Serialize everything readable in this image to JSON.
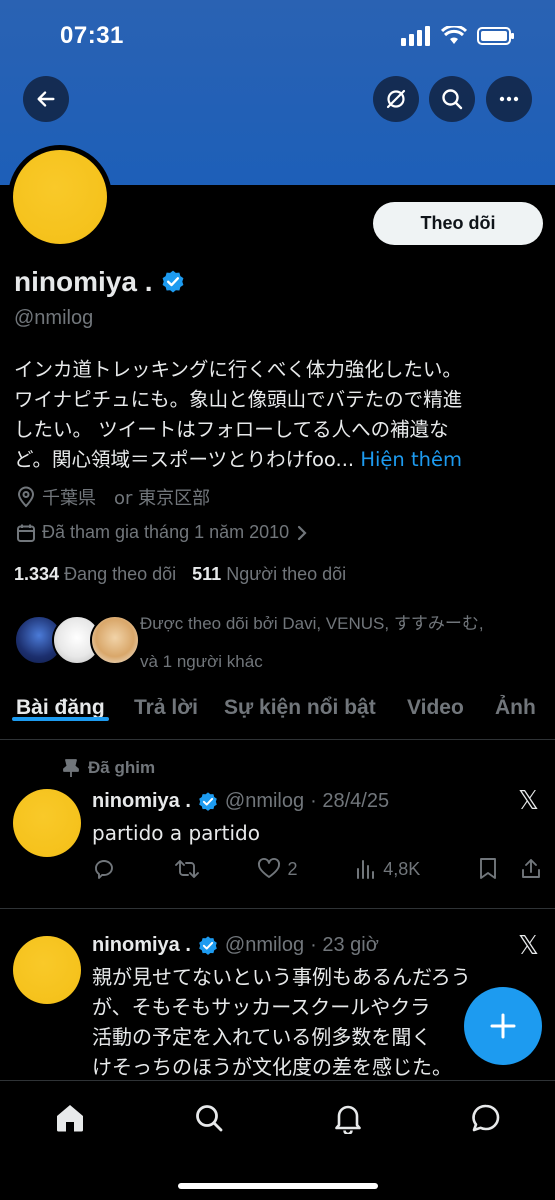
{
  "status_bar": {
    "time": "07:31"
  },
  "profile": {
    "display_name": "ninomiya .",
    "handle": "@nmilog",
    "follow_label": "Theo dõi",
    "bio_lines": [
      "インカ道トレッキングに行くべく体力強化したい。",
      "ワイナピチュにも。象山と像頭山でバテたので精進",
      "したい。 ツイートはフォローしてる人への補遺な",
      "ど。関心領域＝スポーツとりわけfoo..."
    ],
    "bio_more": "Hiện thêm",
    "location": "千葉県　or 東京区部",
    "joined": "Đã tham gia tháng 1 năm 2010",
    "following_count": "1.334",
    "following_label": "Đang theo dõi",
    "followers_count": "511",
    "followers_label": "Người theo dõi",
    "followed_by_line1": "Được theo dõi bởi Davi, VENUS, すすみーむ,",
    "followed_by_line2": "và 1 người khác"
  },
  "tabs": [
    "Bài đăng",
    "Trả lời",
    "Sự kiện nổi bật",
    "Video",
    "Ảnh"
  ],
  "posts": [
    {
      "pinned_label": "Đã ghim",
      "name": "ninomiya .",
      "handle": "@nmilog",
      "time": "· 28/4/25",
      "text": "partido a partido",
      "likes": "2",
      "views": "4,8K"
    },
    {
      "name": "ninomiya .",
      "handle": "@nmilog",
      "time": "· 23 giờ",
      "text_lines": [
        "親が見せてないという事例もあるんだろう",
        "が、そもそもサッカースクールやクラ",
        "活動の予定を入れている例多数を聞く",
        "けそっちのほうが文化度の差を感じた。"
      ]
    }
  ],
  "colors": {
    "accent": "#1d9bf0",
    "banner": "#1d5fb8",
    "avatar": "#f5c21c"
  }
}
